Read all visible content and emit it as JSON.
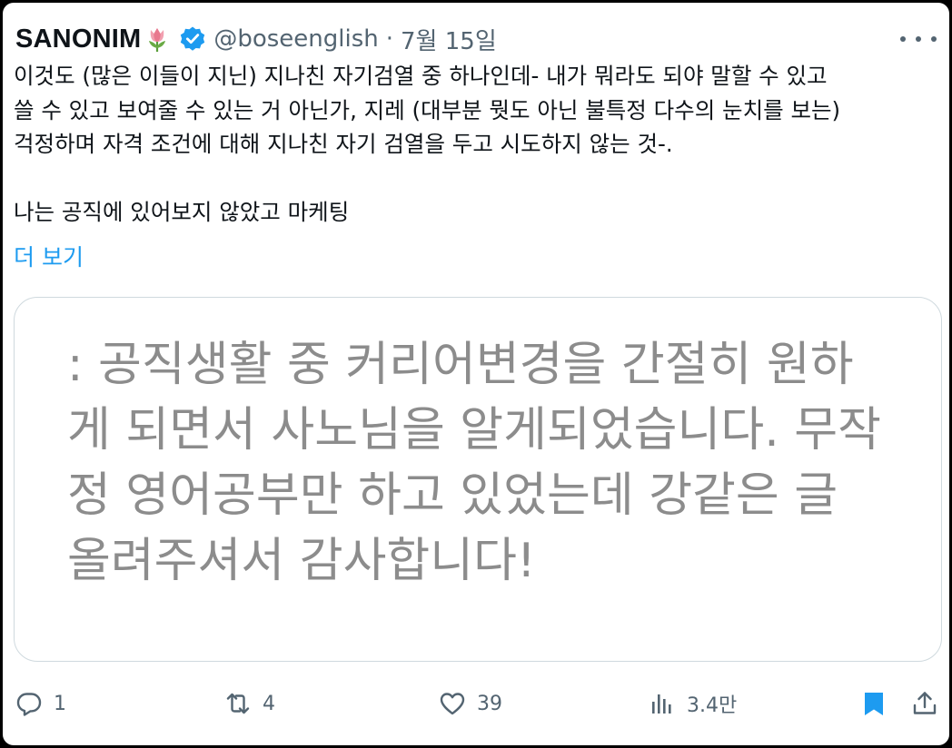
{
  "author": {
    "name": "SANONIM",
    "handle": "@boseenglish",
    "separator": "·",
    "date": "7월 15일"
  },
  "icons": {
    "name_emoji": "tulip-icon",
    "verified": "verified-badge-icon",
    "more": "more-options-icon",
    "reply": "reply-icon",
    "retweet": "retweet-icon",
    "like": "like-icon",
    "views": "views-icon",
    "bookmark": "bookmark-icon",
    "share": "share-icon"
  },
  "tweet": {
    "lines": [
      "이것도 (많은 이들이 지닌) 지나친 자기검열 중 하나인데- 내가 뭐라도 되야 말할 수 있고",
      "쓸 수 있고 보여줄 수 있는 거 아닌가, 지레 (대부분 뭣도 아닌 불특정 다수의 눈치를 보는)",
      "걱정하며 자격 조건에 대해 지나친 자기 검열을 두고 시도하지 않는 것-.",
      "나는 공직에 있어보지 않았고 마케팅"
    ],
    "show_more": "더 보기"
  },
  "quote": {
    "lines": [
      ": 공직생활 중 커리어변경을 간절히 원하",
      "게 되면서 사노님을 알게되었습니다. 무작",
      "정 영어공부만 하고 있었는데 강같은 글",
      "올려주셔서 감사합니다!"
    ]
  },
  "actions": {
    "reply_count": "1",
    "retweet_count": "4",
    "like_count": "39",
    "views_count": "3.4만"
  },
  "colors": {
    "accent": "#1d9bf0",
    "bookmark": "#1d9bf0",
    "text": "#0f1419",
    "secondary": "#536471",
    "quote_text": "#8c8c8c",
    "border": "#cfd9de"
  }
}
